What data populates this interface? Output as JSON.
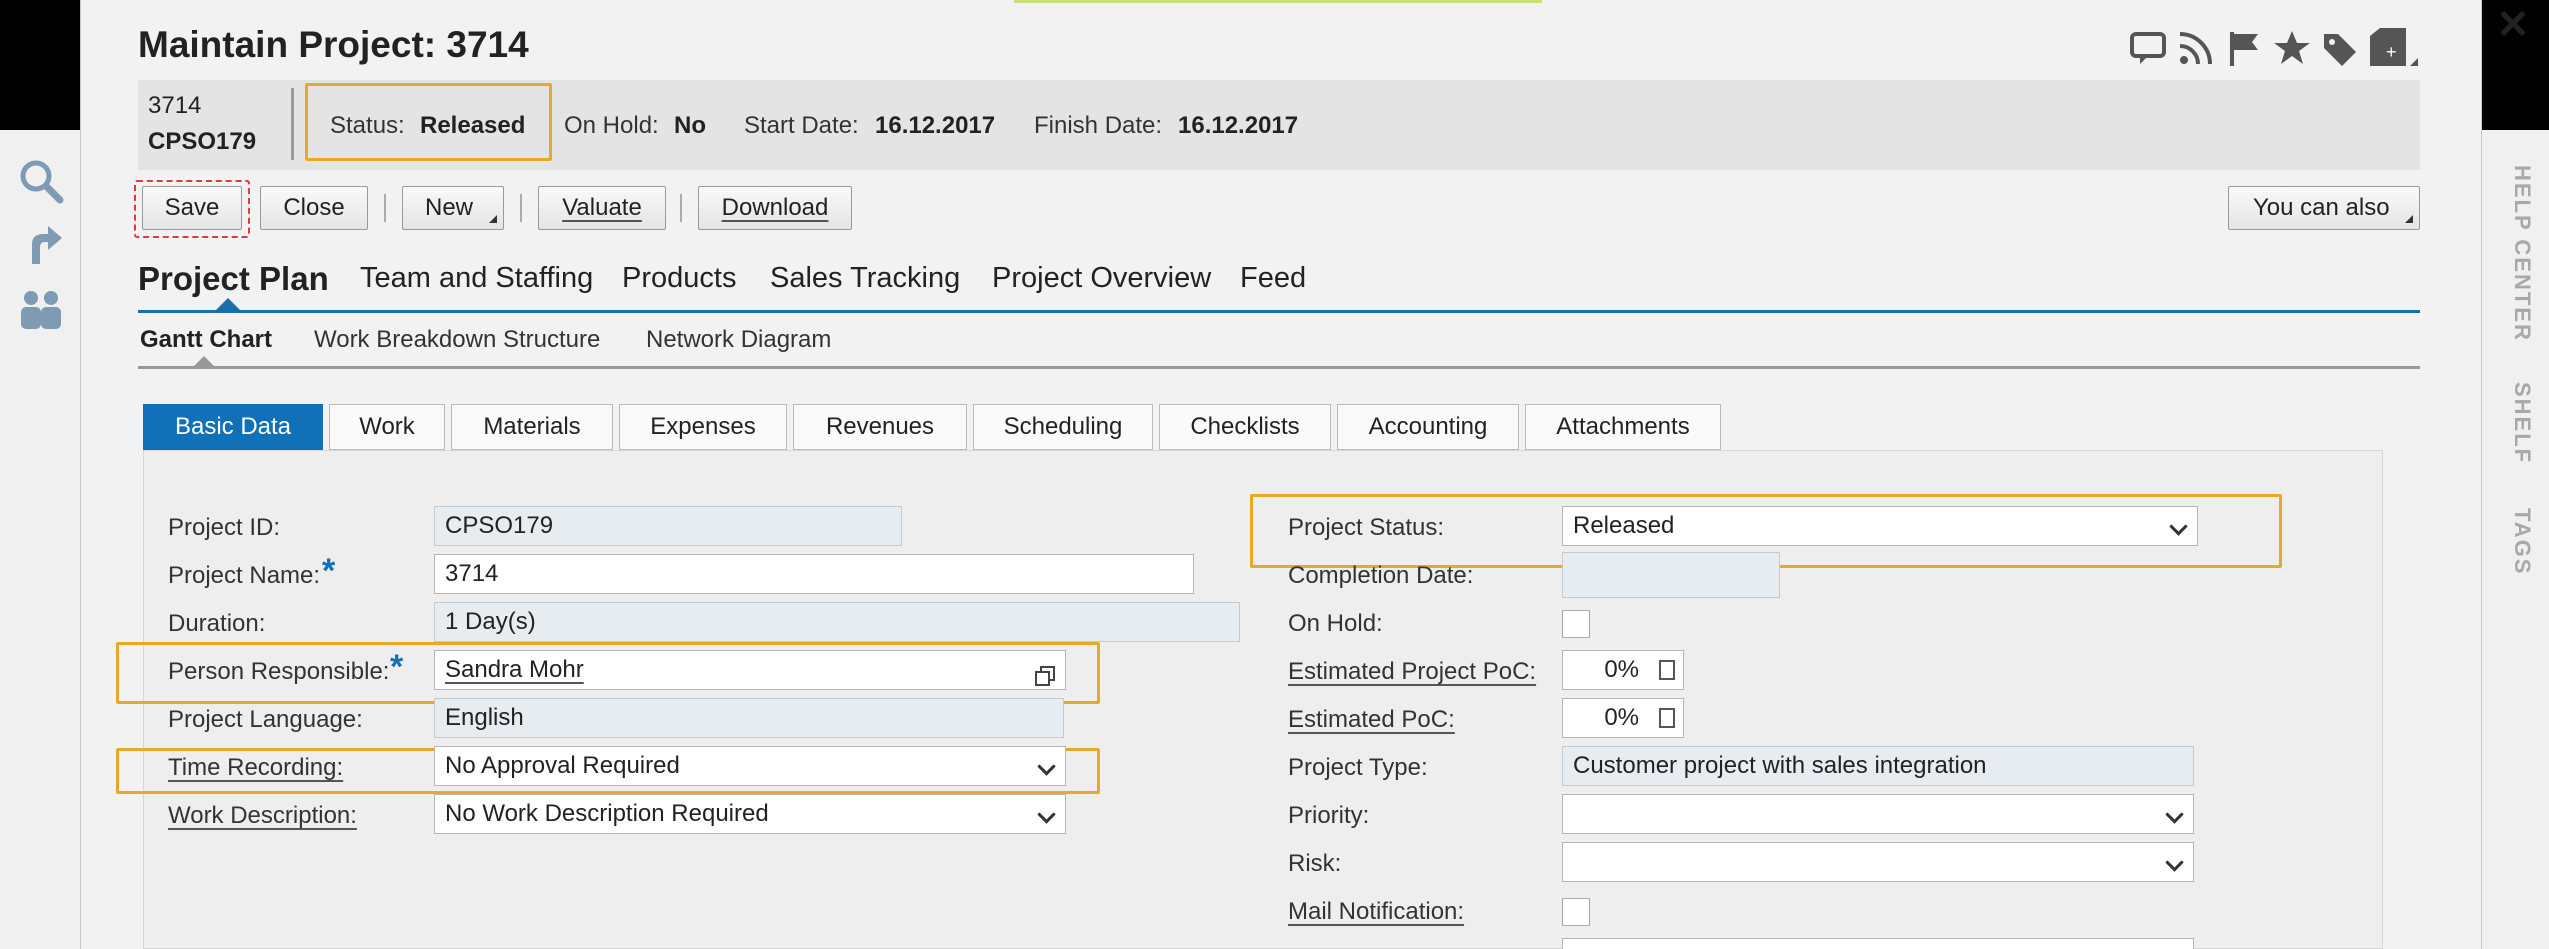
{
  "window": {
    "title": "Maintain Project: 3714",
    "close_icon": "close-icon"
  },
  "header_icons": [
    "comment-icon",
    "rss-icon",
    "flag-icon",
    "star-icon",
    "tag-icon",
    "new-document-icon"
  ],
  "left_sidebar": [
    "search-icon",
    "arrow-icon",
    "people-icon"
  ],
  "right_sidebar": {
    "help_center": "HELP CENTER",
    "shelf": "SHELF",
    "tags": "TAGS"
  },
  "info_bar": {
    "object_id": "3714",
    "object_name": "CPSO179",
    "status_label": "Status:",
    "status_value": "Released",
    "on_hold_label": "On Hold:",
    "on_hold_value": "No",
    "start_date_label": "Start Date:",
    "start_date_value": "16.12.2017",
    "finish_date_label": "Finish Date:",
    "finish_date_value": "16.12.2017"
  },
  "toolbar": {
    "save": "Save",
    "close": "Close",
    "new": "New",
    "valuate": "Valuate",
    "download": "Download",
    "you_can_also": "You can also"
  },
  "main_tabs": [
    "Project Plan",
    "Team and Staffing",
    "Products",
    "Sales Tracking",
    "Project Overview",
    "Feed"
  ],
  "sub_tabs": [
    "Gantt Chart",
    "Work Breakdown Structure",
    "Network Diagram"
  ],
  "detail_tabs": [
    "Basic Data",
    "Work",
    "Materials",
    "Expenses",
    "Revenues",
    "Scheduling",
    "Checklists",
    "Accounting",
    "Attachments"
  ],
  "form_left": {
    "project_id_label": "Project ID:",
    "project_id_value": "CPSO179",
    "project_name_label": "Project Name:",
    "project_name_value": "3714",
    "duration_label": "Duration:",
    "duration_value": "1 Day(s)",
    "person_responsible_label": "Person Responsible:",
    "person_responsible_value": "Sandra Mohr",
    "project_language_label": "Project Language:",
    "project_language_value": "English",
    "time_recording_label": "Time Recording:",
    "time_recording_value": "No Approval Required",
    "work_description_label": "Work Description:",
    "work_description_value": "No Work Description Required",
    "required_marker": "*"
  },
  "form_right": {
    "project_status_label": "Project Status:",
    "project_status_value": "Released",
    "completion_date_label": "Completion Date:",
    "completion_date_value": "",
    "on_hold_label": "On Hold:",
    "estimated_project_poc_label": "Estimated Project PoC:",
    "estimated_project_poc_value": "0%",
    "estimated_poc_label": "Estimated PoC:",
    "estimated_poc_value": "0%",
    "project_type_label": "Project Type:",
    "project_type_value": "Customer project with sales integration",
    "priority_label": "Priority:",
    "priority_value": "",
    "risk_label": "Risk:",
    "risk_value": "",
    "mail_notification_label": "Mail Notification:"
  },
  "colors": {
    "accent_blue": "#1070b8",
    "highlight_orange": "#e8a92a",
    "required_marker": "#1070b8"
  }
}
